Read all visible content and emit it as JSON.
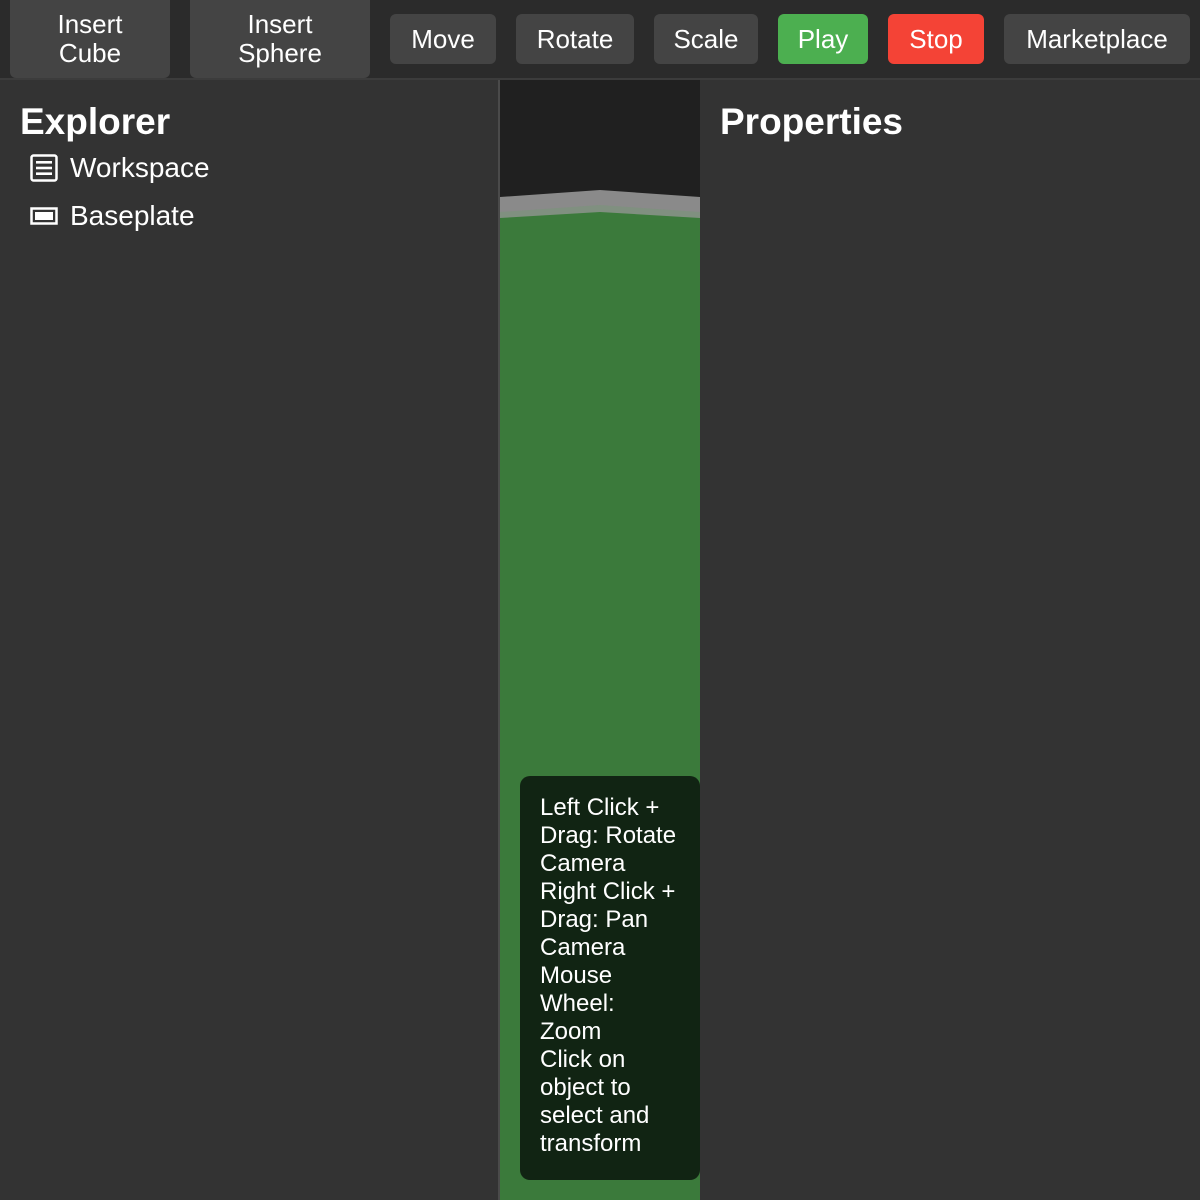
{
  "toolbar": {
    "insert_cube": "Insert\nCube",
    "insert_sphere": "Insert\nSphere",
    "move": "Move",
    "rotate": "Rotate",
    "scale": "Scale",
    "play": "Play",
    "stop": "Stop",
    "marketplace": "Marketplace",
    "play_color": "#4caf50",
    "stop_color": "#f44336"
  },
  "explorer": {
    "title": "Explorer",
    "items": [
      {
        "label": "Workspace",
        "icon": "list-icon"
      },
      {
        "label": "Baseplate",
        "icon": "part-icon"
      }
    ]
  },
  "viewport": {
    "ground_color": "#3b7a3b",
    "hint": "Left Click +\nDrag: Rotate\nCamera\nRight Click +\nDrag: Pan\nCamera\nMouse\nWheel:\nZoom\nClick on\nobject to\nselect and\ntransform"
  },
  "properties": {
    "title": "Properties"
  }
}
